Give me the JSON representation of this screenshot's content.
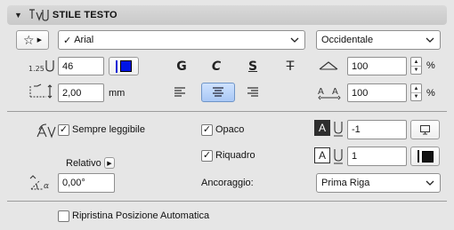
{
  "header": {
    "title": "STILE TESTO",
    "collapse_icon": "disclosure-triangle-down",
    "icon": "text-style-icon"
  },
  "font": {
    "selected": "Arial",
    "script": "Occidentale"
  },
  "size": {
    "value": "46",
    "pen_color": "#0014e6"
  },
  "format_buttons": {
    "bold": "G",
    "italic": "C",
    "underline": "S",
    "strike": "T"
  },
  "width_factor": {
    "value": "100",
    "unit": "%"
  },
  "spacing": {
    "value": "100",
    "unit": "%"
  },
  "rotation_distance": {
    "value": "2,00",
    "unit": "mm"
  },
  "alignment": {
    "options": [
      "left",
      "center",
      "right"
    ],
    "selected": "center"
  },
  "options": {
    "always_readable": {
      "label": "Sempre leggibile",
      "checked": true
    },
    "opaque": {
      "label": "Opaco",
      "checked": true
    },
    "frame": {
      "label": "Riquadro",
      "checked": true
    }
  },
  "background_pen": {
    "value": "-1"
  },
  "frame_pen": {
    "value": "1",
    "color": "#111111"
  },
  "relative": {
    "label": "Relativo"
  },
  "angle": {
    "value": "0,00°"
  },
  "anchor": {
    "label": "Ancoraggio:",
    "selected": "Prima Riga"
  },
  "restore": {
    "label": "Ripristina Posizione Automatica",
    "checked": false
  }
}
